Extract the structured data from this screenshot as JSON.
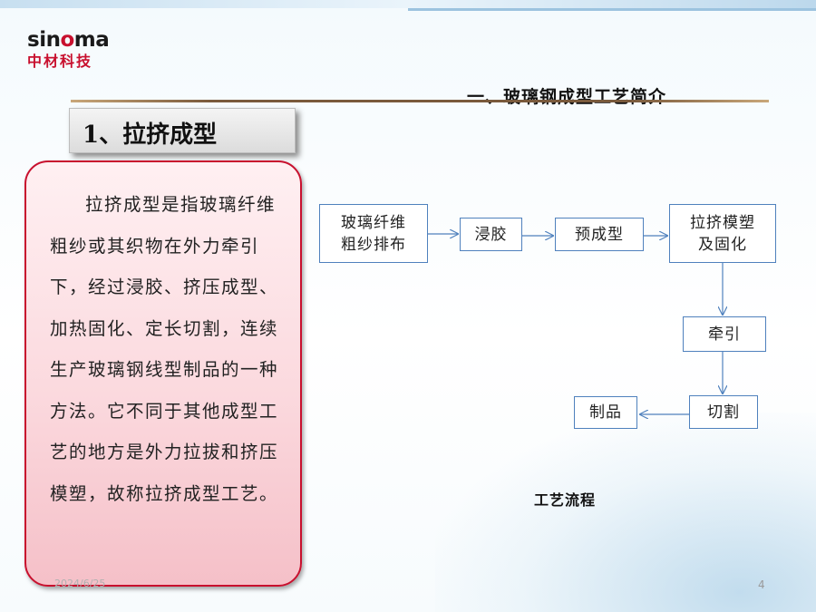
{
  "logo": {
    "brand_prefix": "sin",
    "brand_o": "o",
    "brand_suffix": "ma",
    "brand_cn": "中材科技"
  },
  "section_title": "一、玻璃钢成型工艺简介",
  "heading": "1、拉挤成型",
  "description": "拉挤成型是指玻璃纤维粗纱或其织物在外力牵引下，经过浸胶、挤压成型、加热固化、定长切割，连续生产玻璃钢线型制品的一种方法。它不同于其他成型工艺的地方是外力拉拔和挤压模塑，故称拉挤成型工艺。",
  "flow": {
    "nodes": {
      "fiber": [
        "玻璃纤维",
        "粗纱排布"
      ],
      "impregnate": "浸胶",
      "preform": "预成型",
      "mold": [
        "拉挤模塑",
        "及固化"
      ],
      "pull": "牵引",
      "cut": "切割",
      "product": "制品"
    },
    "caption": "工艺流程"
  },
  "footer": {
    "date": "2024/6/25",
    "page_number": "4"
  },
  "colors": {
    "accent_red": "#c8102e",
    "flow_blue": "#4f81bd",
    "card_pink": "#fbd9de"
  }
}
